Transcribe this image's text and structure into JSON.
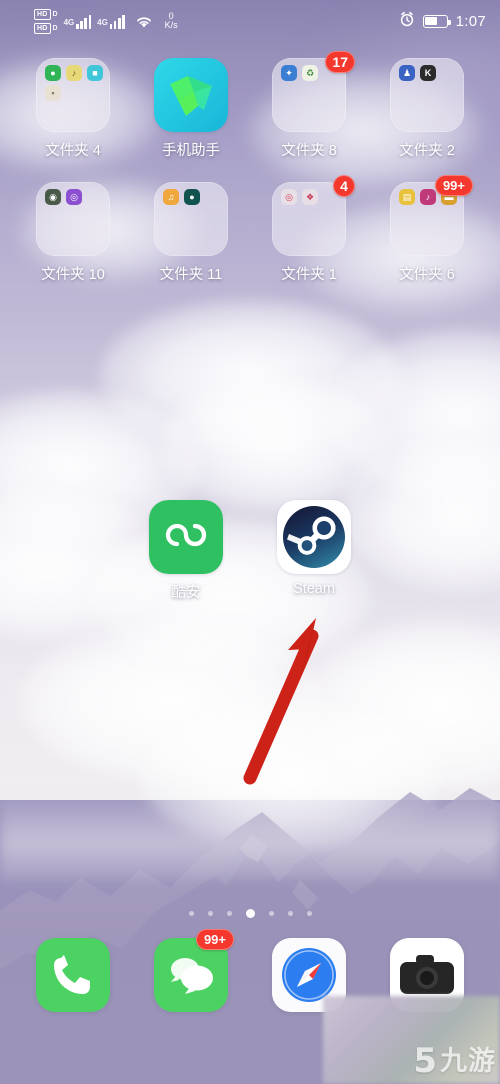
{
  "status_bar": {
    "hd_label_1": "HD",
    "hd_sub_1": "D",
    "hd_label_2": "HD",
    "hd_sub_2": "D",
    "network_1": "4G",
    "network_2": "4G",
    "wifi_icon": "wifi-icon",
    "net_speed_value": "0",
    "net_speed_unit": "K/s",
    "alarm_icon": "alarm-clock-icon",
    "battery_icon": "battery-icon",
    "battery_percent": 60,
    "time": "1:07"
  },
  "home": {
    "rows": [
      {
        "items": [
          {
            "type": "folder",
            "name": "文件夹 4",
            "badge": null,
            "minis": [
              {
                "icon": "green-app-icon",
                "color": "#2fb457",
                "glyph": "●"
              },
              {
                "icon": "yellow-music-icon",
                "color": "#e8d978",
                "glyph": "♪"
              },
              {
                "icon": "cyan-app-icon",
                "color": "#3fc6d8",
                "glyph": "■"
              },
              {
                "icon": "beige-app-icon",
                "color": "#e8e0d2",
                "glyph": "▪"
              }
            ]
          },
          {
            "type": "app",
            "name": "手机助手",
            "icon": "phone-assistant-icon",
            "badge": null
          },
          {
            "type": "folder",
            "name": "文件夹 8",
            "badge": "17",
            "minis": [
              {
                "icon": "blue-app-icon",
                "color": "#3b7fd4",
                "glyph": "✦"
              },
              {
                "icon": "white-green-app-icon",
                "color": "#eef3e6",
                "glyph": "♻"
              }
            ]
          },
          {
            "type": "folder",
            "name": "文件夹 2",
            "badge": null,
            "minis": [
              {
                "icon": "blue-people-icon",
                "color": "#3a63c4",
                "glyph": "♟"
              },
              {
                "icon": "dark-k-icon",
                "color": "#2b2b2b",
                "glyph": "K"
              }
            ]
          }
        ]
      },
      {
        "items": [
          {
            "type": "folder",
            "name": "文件夹 10",
            "badge": null,
            "minis": [
              {
                "icon": "dark-camera-icon",
                "color": "#4a5a48",
                "glyph": "◉"
              },
              {
                "icon": "purple-chat-icon",
                "color": "#8b4fd0",
                "glyph": "◎"
              }
            ]
          },
          {
            "type": "folder",
            "name": "文件夹 11",
            "badge": null,
            "minis": [
              {
                "icon": "orange-app-icon",
                "color": "#f0a83c",
                "glyph": "♫"
              },
              {
                "icon": "teal-dark-icon",
                "color": "#11544f",
                "glyph": "●"
              }
            ]
          },
          {
            "type": "folder",
            "name": "文件夹 1",
            "badge": "4",
            "minis": [
              {
                "icon": "red-circle-icon",
                "color": "#e24a4a",
                "glyph": "◎"
              },
              {
                "icon": "red-app-icon",
                "color": "#d63a52",
                "glyph": "❖"
              }
            ]
          },
          {
            "type": "folder",
            "name": "文件夹 6",
            "badge": "99+",
            "minis": [
              {
                "icon": "yellow-note-icon",
                "color": "#e8c23c",
                "glyph": "▤"
              },
              {
                "icon": "magenta-app-icon",
                "color": "#c03a7a",
                "glyph": "♪"
              },
              {
                "icon": "gold-app-icon",
                "color": "#d8a030",
                "glyph": "▬"
              }
            ]
          }
        ]
      }
    ],
    "middle_apps": [
      {
        "type": "app",
        "name": "酷安",
        "icon": "coolapk-icon",
        "badge": null
      },
      {
        "type": "app",
        "name": "Steam",
        "icon": "steam-icon",
        "badge": null
      }
    ]
  },
  "annotation": {
    "arrow_icon": "red-arrow-up-icon",
    "arrow_color": "#cc2218",
    "points_to": "Steam"
  },
  "page_indicator": {
    "total": 7,
    "active_index": 3
  },
  "dock": {
    "items": [
      {
        "name": "phone-app",
        "icon": "phone-icon",
        "badge": null
      },
      {
        "name": "messages-app",
        "icon": "messages-icon",
        "badge": "99+"
      },
      {
        "name": "safari-app",
        "icon": "safari-compass-icon",
        "badge": null
      },
      {
        "name": "camera-app",
        "icon": "camera-icon",
        "badge": null
      }
    ]
  },
  "watermark": {
    "glyph": "5",
    "text": "九游"
  },
  "colors": {
    "badge_red": "#f5382e",
    "accent_green": "#34c759",
    "arrow_red": "#cc2218",
    "wallpaper_sky": "#a59dc6"
  }
}
